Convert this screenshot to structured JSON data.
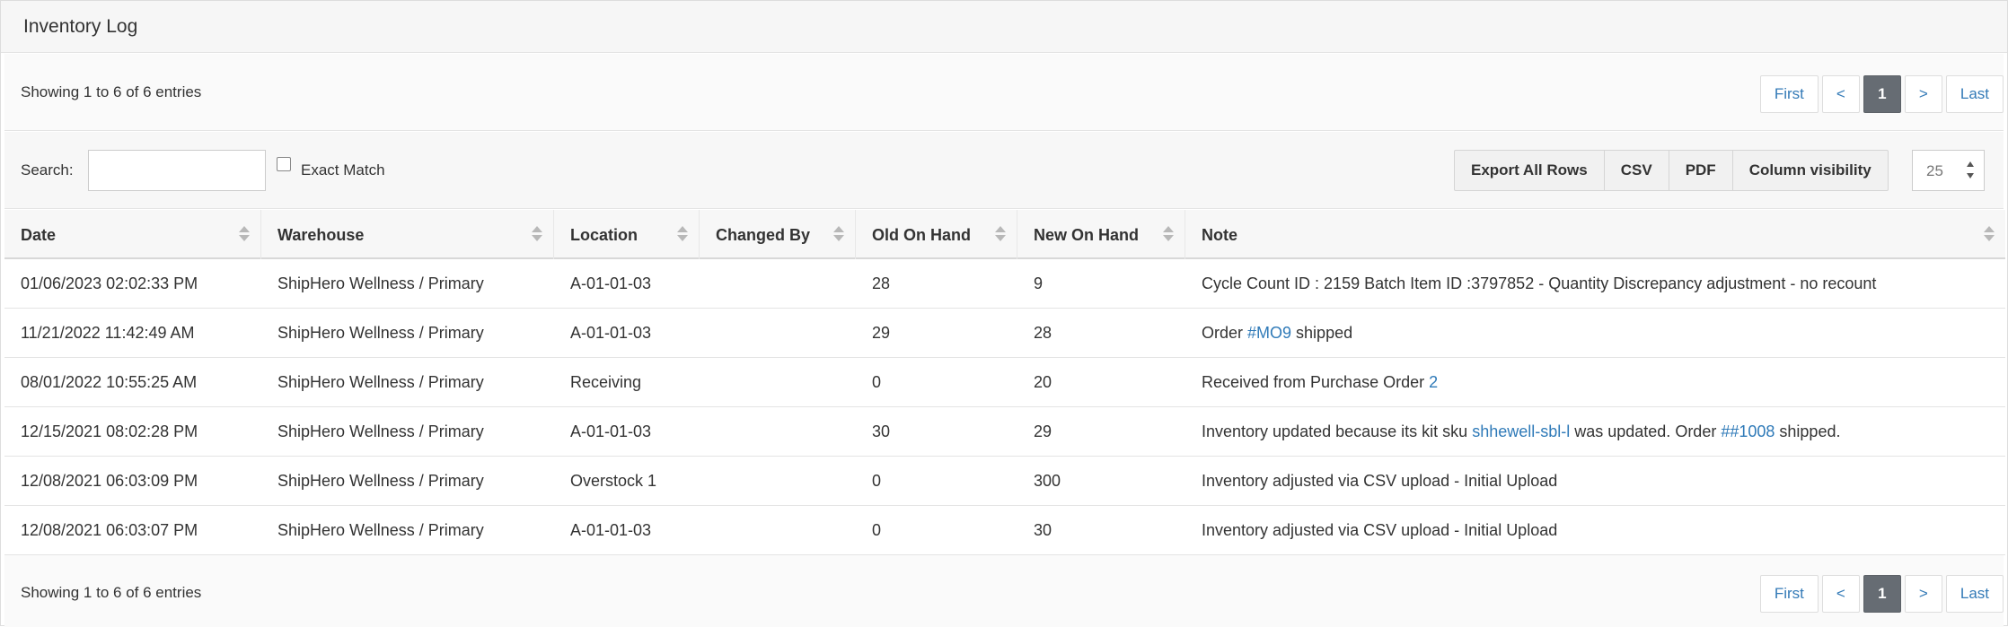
{
  "title": "Inventory Log",
  "info": {
    "text": "Showing 1 to 6 of 6 entries"
  },
  "pagination": {
    "first": "First",
    "prev": "<",
    "current": "1",
    "next": ">",
    "last": "Last"
  },
  "search": {
    "label": "Search:",
    "value": "",
    "exact_match_label": "Exact Match",
    "exact_match_checked": false
  },
  "export_buttons": {
    "export_all": "Export All Rows",
    "csv": "CSV",
    "pdf": "PDF",
    "column_visibility": "Column visibility"
  },
  "page_length": {
    "value": "25"
  },
  "table": {
    "columns": [
      "Date",
      "Warehouse",
      "Location",
      "Changed By",
      "Old On Hand",
      "New On Hand",
      "Note"
    ],
    "rows": [
      {
        "date": "01/06/2023 02:02:33 PM",
        "warehouse": "ShipHero Wellness / Primary",
        "location": "A-01-01-03",
        "changed_by": "",
        "old": "28",
        "new": "9",
        "note": [
          {
            "text": "Cycle Count ID : 2159 Batch Item ID :3797852 - Quantity Discrepancy adjustment - no recount",
            "link": false
          }
        ]
      },
      {
        "date": "11/21/2022 11:42:49 AM",
        "warehouse": "ShipHero Wellness / Primary",
        "location": "A-01-01-03",
        "changed_by": "",
        "old": "29",
        "new": "28",
        "note": [
          {
            "text": "Order ",
            "link": false
          },
          {
            "text": "#MO9",
            "link": true
          },
          {
            "text": " shipped",
            "link": false
          }
        ]
      },
      {
        "date": "08/01/2022 10:55:25 AM",
        "warehouse": "ShipHero Wellness / Primary",
        "location": "Receiving",
        "changed_by": "",
        "old": "0",
        "new": "20",
        "note": [
          {
            "text": "Received from Purchase Order ",
            "link": false
          },
          {
            "text": "2",
            "link": true
          }
        ]
      },
      {
        "date": "12/15/2021 08:02:28 PM",
        "warehouse": "ShipHero Wellness / Primary",
        "location": "A-01-01-03",
        "changed_by": "",
        "old": "30",
        "new": "29",
        "note": [
          {
            "text": "Inventory updated because its kit sku ",
            "link": false
          },
          {
            "text": "shhewell-sbl-l",
            "link": true
          },
          {
            "text": " was updated. Order ",
            "link": false
          },
          {
            "text": "##1008",
            "link": true
          },
          {
            "text": " shipped.",
            "link": false
          }
        ]
      },
      {
        "date": "12/08/2021 06:03:09 PM",
        "warehouse": "ShipHero Wellness / Primary",
        "location": "Overstock 1",
        "changed_by": "",
        "old": "0",
        "new": "300",
        "note": [
          {
            "text": "Inventory adjusted via CSV upload - Initial Upload",
            "link": false
          }
        ]
      },
      {
        "date": "12/08/2021 06:03:07 PM",
        "warehouse": "ShipHero Wellness / Primary",
        "location": "A-01-01-03",
        "changed_by": "",
        "old": "0",
        "new": "30",
        "note": [
          {
            "text": "Inventory adjusted via CSV upload - Initial Upload",
            "link": false
          }
        ]
      }
    ]
  }
}
